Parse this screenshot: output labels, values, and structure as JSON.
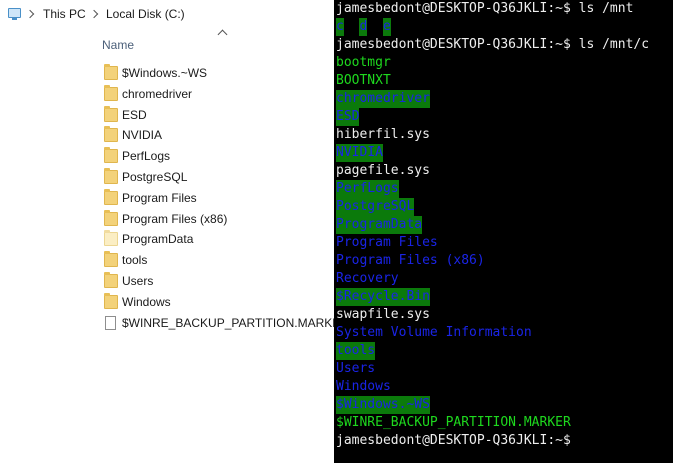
{
  "explorer": {
    "breadcrumb": [
      "This PC",
      "Local Disk (C:)"
    ],
    "column_header": "Name",
    "items": [
      {
        "name": "$Windows.~WS",
        "type": "folder"
      },
      {
        "name": "chromedriver",
        "type": "folder"
      },
      {
        "name": "ESD",
        "type": "folder"
      },
      {
        "name": "NVIDIA",
        "type": "folder"
      },
      {
        "name": "PerfLogs",
        "type": "folder"
      },
      {
        "name": "PostgreSQL",
        "type": "folder"
      },
      {
        "name": "Program Files",
        "type": "folder"
      },
      {
        "name": "Program Files (x86)",
        "type": "folder"
      },
      {
        "name": "ProgramData",
        "type": "folder-light"
      },
      {
        "name": "tools",
        "type": "folder"
      },
      {
        "name": "Users",
        "type": "folder"
      },
      {
        "name": "Windows",
        "type": "folder"
      },
      {
        "name": "$WINRE_BACKUP_PARTITION.MARKER",
        "type": "file"
      }
    ]
  },
  "terminal": {
    "colors": {
      "background": "#000000",
      "text": "#eeeeee",
      "green": "#1ed81e",
      "blue": "#1a24e6",
      "highlight": "#0b7a0b"
    },
    "lines": [
      {
        "segments": [
          {
            "text": "jamesbedont@DESKTOP-Q36JKLI:~$ ls /mnt",
            "style": "prompt"
          }
        ]
      },
      {
        "segments": [
          {
            "text": "c",
            "style": "blue-hl"
          },
          {
            "text": "  ",
            "style": "plain"
          },
          {
            "text": "d",
            "style": "blue-hl"
          },
          {
            "text": "  ",
            "style": "plain"
          },
          {
            "text": "e",
            "style": "blue-hl"
          }
        ]
      },
      {
        "segments": [
          {
            "text": "jamesbedont@DESKTOP-Q36JKLI:~$ ls /mnt/c",
            "style": "prompt"
          }
        ]
      },
      {
        "segments": [
          {
            "text": "bootmgr",
            "style": "green"
          }
        ]
      },
      {
        "segments": [
          {
            "text": "BOOTNXT",
            "style": "green"
          }
        ]
      },
      {
        "segments": [
          {
            "text": "chromedriver",
            "style": "blue-hl"
          }
        ]
      },
      {
        "segments": [
          {
            "text": "ESD",
            "style": "blue-hl"
          }
        ]
      },
      {
        "segments": [
          {
            "text": "hiberfil.sys",
            "style": "white"
          }
        ]
      },
      {
        "segments": [
          {
            "text": "NVIDIA",
            "style": "blue-hl"
          }
        ]
      },
      {
        "segments": [
          {
            "text": "pagefile.sys",
            "style": "white"
          }
        ]
      },
      {
        "segments": [
          {
            "text": "PerfLogs",
            "style": "blue-hl"
          }
        ]
      },
      {
        "segments": [
          {
            "text": "PostgreSQL",
            "style": "blue-hl"
          }
        ]
      },
      {
        "segments": [
          {
            "text": "ProgramData",
            "style": "blue-hl"
          }
        ]
      },
      {
        "segments": [
          {
            "text": "Program Files",
            "style": "blue"
          }
        ]
      },
      {
        "segments": [
          {
            "text": "Program Files (x86)",
            "style": "blue"
          }
        ]
      },
      {
        "segments": [
          {
            "text": "Recovery",
            "style": "blue"
          }
        ]
      },
      {
        "segments": [
          {
            "text": "$Recycle.Bin",
            "style": "blue-hl"
          }
        ]
      },
      {
        "segments": [
          {
            "text": "swapfile.sys",
            "style": "white"
          }
        ]
      },
      {
        "segments": [
          {
            "text": "System Volume Information",
            "style": "blue"
          }
        ]
      },
      {
        "segments": [
          {
            "text": "tools",
            "style": "blue-hl"
          }
        ]
      },
      {
        "segments": [
          {
            "text": "Users",
            "style": "blue"
          }
        ]
      },
      {
        "segments": [
          {
            "text": "Windows",
            "style": "blue"
          }
        ]
      },
      {
        "segments": [
          {
            "text": "$Windows.~WS",
            "style": "blue-hl"
          }
        ]
      },
      {
        "segments": [
          {
            "text": "$WINRE_BACKUP_PARTITION.MARKER",
            "style": "green"
          }
        ]
      },
      {
        "segments": [
          {
            "text": "jamesbedont@DESKTOP-Q36JKLI:~$",
            "style": "prompt"
          }
        ]
      }
    ]
  }
}
